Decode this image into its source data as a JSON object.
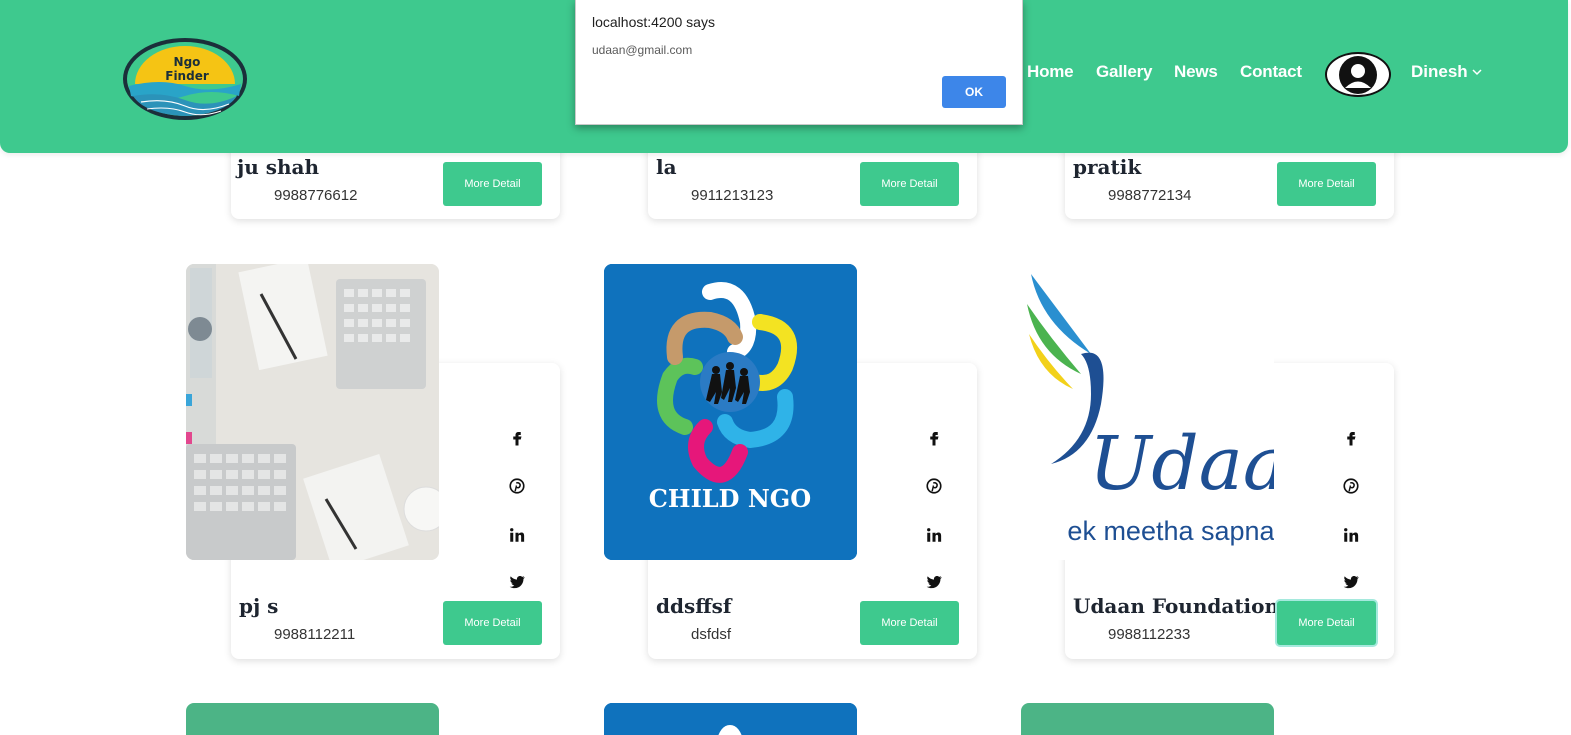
{
  "header": {
    "logo_line1": "Ngo",
    "logo_line2": "Finder",
    "nav": [
      "Home",
      "Gallery",
      "News",
      "Contact"
    ],
    "user_name": "Dinesh"
  },
  "alert": {
    "title": "localhost:4200 says",
    "message": "udaan@gmail.com",
    "ok_label": "OK"
  },
  "top_cards": [
    {
      "name": "ju shah",
      "phone": "9988776612",
      "button": "More Detail"
    },
    {
      "name": "la",
      "phone": "9911213123",
      "button": "More Detail"
    },
    {
      "name": "pratik",
      "phone": "9988772134",
      "button": "More Detail"
    }
  ],
  "cards": [
    {
      "name": "pj s",
      "phone": "9988112211",
      "button": "More Detail"
    },
    {
      "name": "ddsffsf",
      "phone": "dsfdsf",
      "button": "More Detail",
      "image_text": "CHILD NGO"
    },
    {
      "name": "Udaan Foundation",
      "phone": "9988112233",
      "button": "More Detail",
      "image_text_1": "Udaan",
      "image_text_2": "ek meetha sapna"
    }
  ],
  "colors": {
    "primary": "#3ec98e",
    "alert_button": "#3d86e9",
    "child_ngo_bg": "#0f72bd",
    "udaan_text": "#1e4f93"
  },
  "icons": [
    "facebook-icon",
    "pinterest-icon",
    "linkedin-icon",
    "twitter-icon"
  ]
}
